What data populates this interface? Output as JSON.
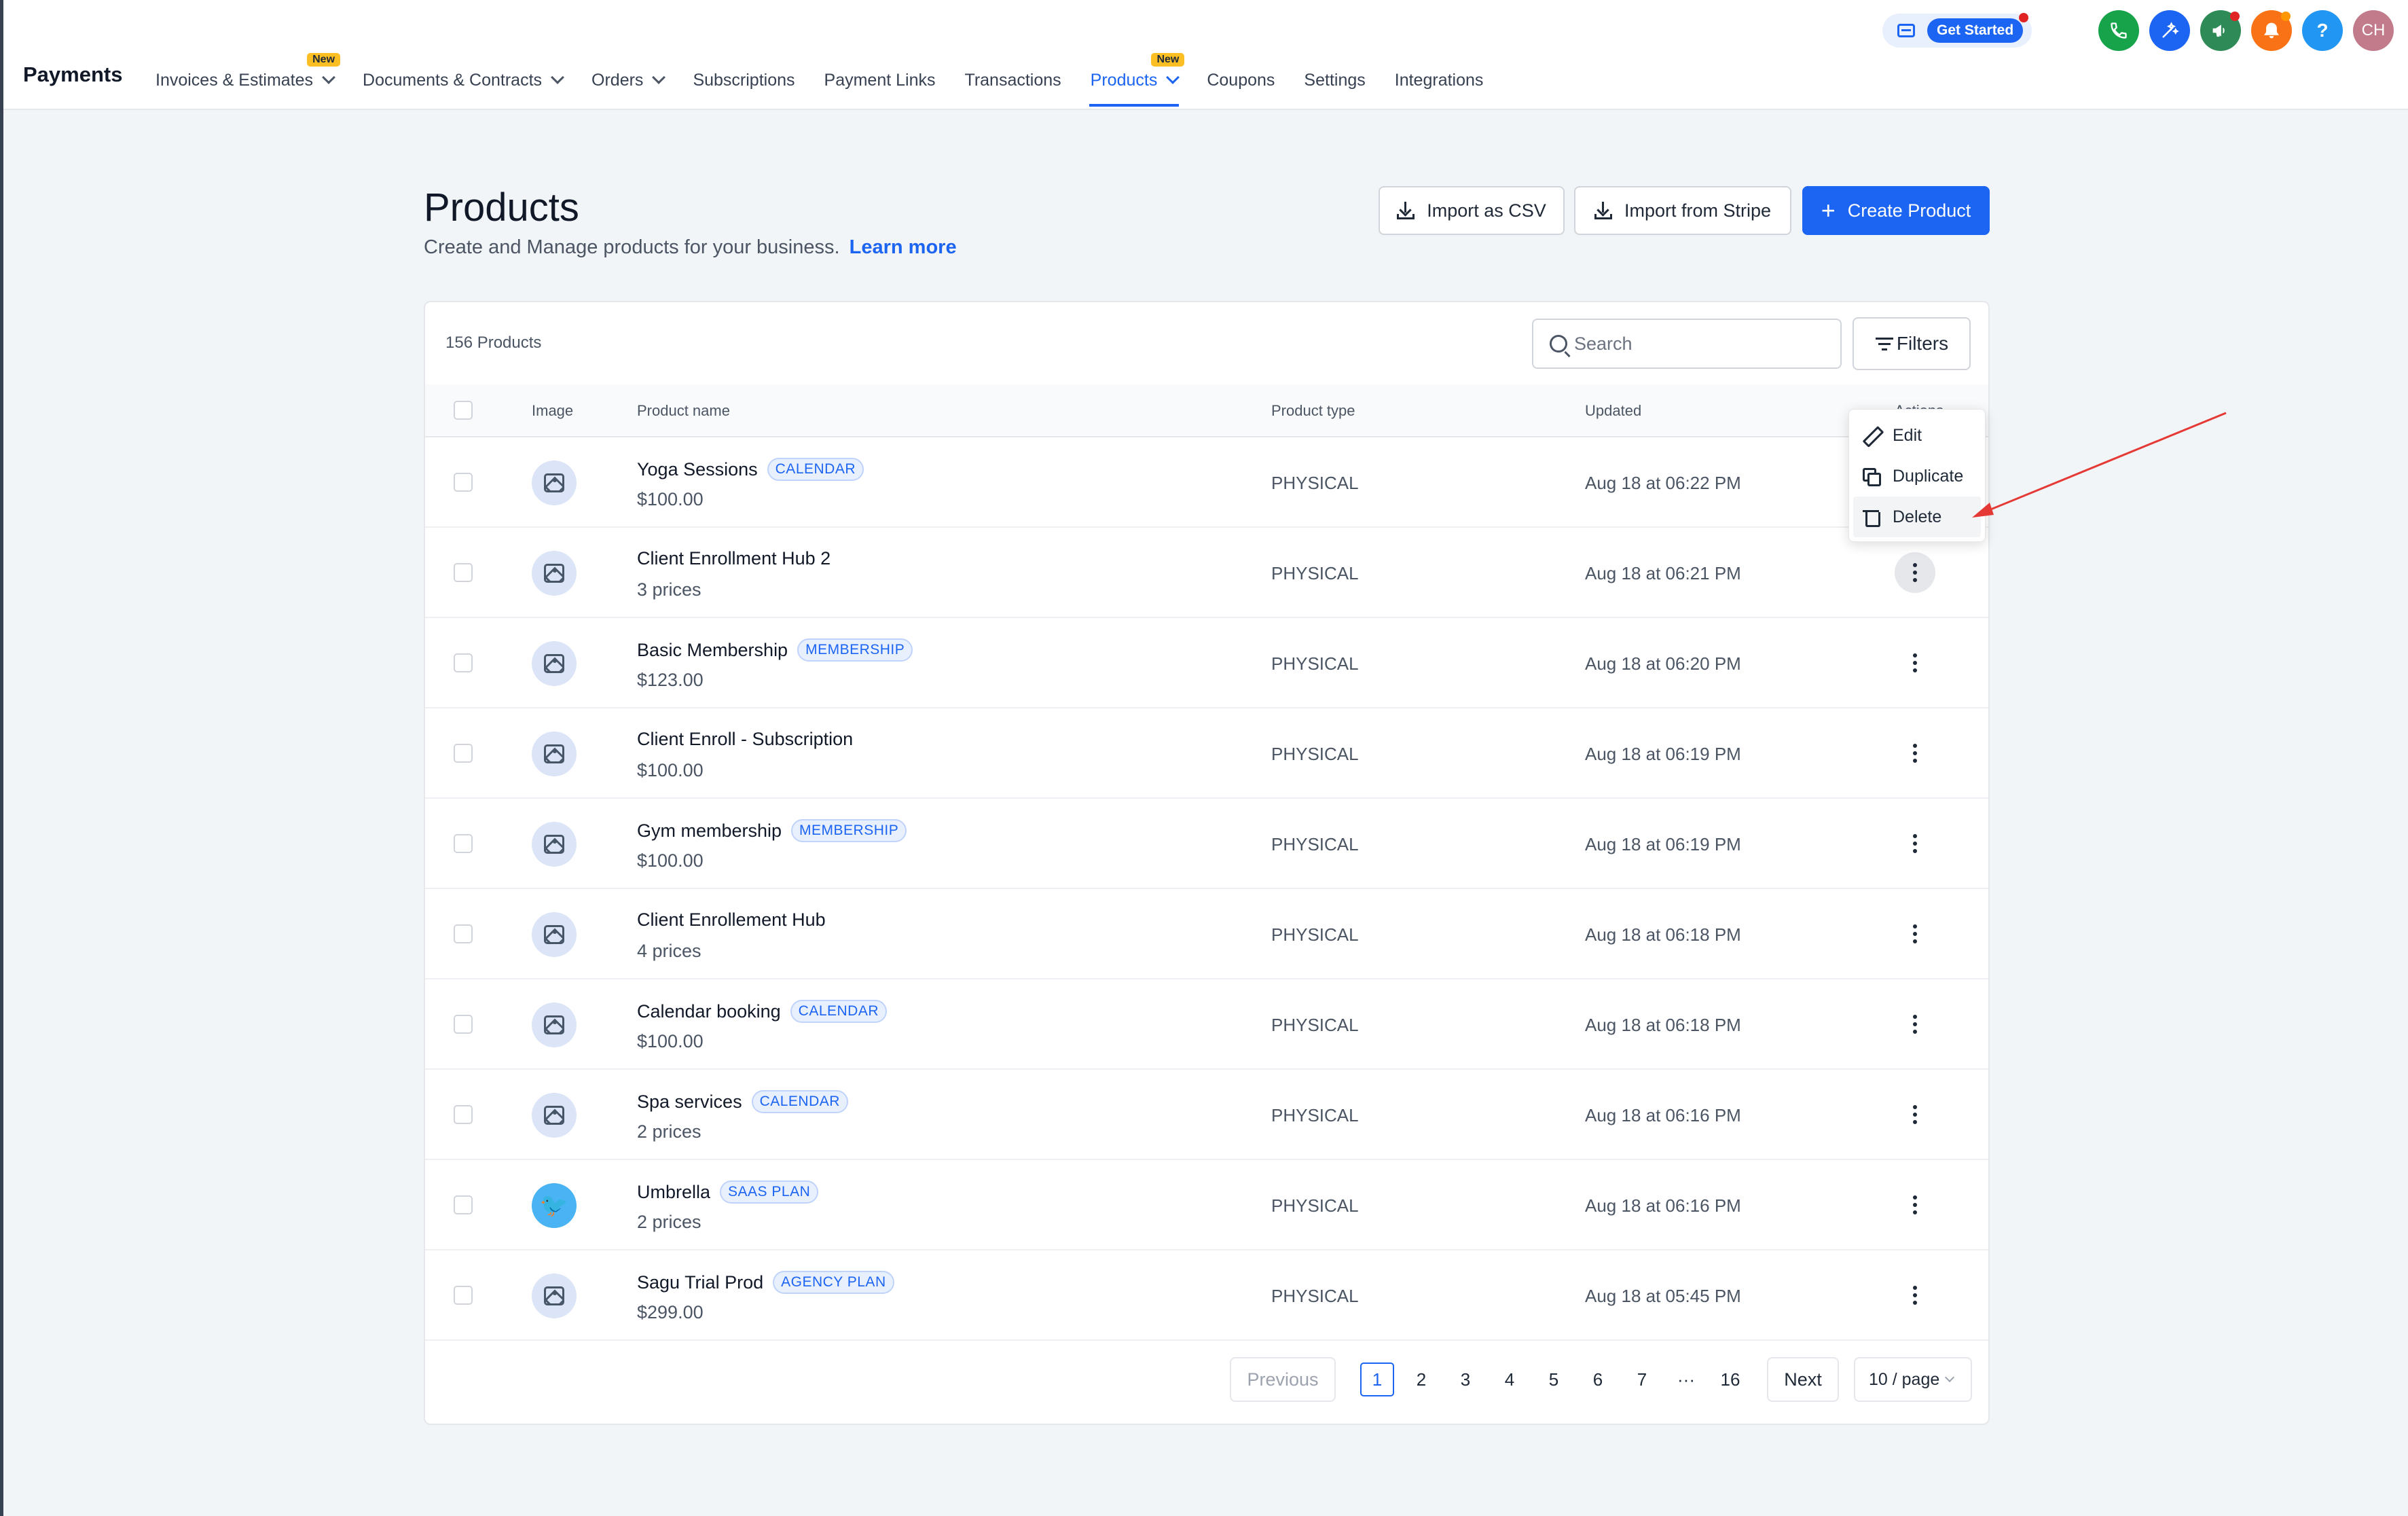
{
  "app": {
    "title": "Payments"
  },
  "nav": {
    "items": [
      {
        "label": "Invoices & Estimates",
        "dropdown": true,
        "badge": "New"
      },
      {
        "label": "Documents & Contracts",
        "dropdown": true
      },
      {
        "label": "Orders",
        "dropdown": true
      },
      {
        "label": "Subscriptions"
      },
      {
        "label": "Payment Links"
      },
      {
        "label": "Transactions"
      },
      {
        "label": "Products",
        "dropdown": true,
        "badge": "New",
        "active": true
      },
      {
        "label": "Coupons"
      },
      {
        "label": "Settings"
      },
      {
        "label": "Integrations"
      }
    ]
  },
  "topbar": {
    "get_started": "Get Started",
    "icons": [
      {
        "name": "phone-icon",
        "color": "#16a34a"
      },
      {
        "name": "magic-icon",
        "color": "#1c64f2"
      },
      {
        "name": "megaphone-icon",
        "color": "#2e8b57"
      },
      {
        "name": "bell-icon",
        "color": "#f97316"
      },
      {
        "name": "help-icon",
        "color": "#2196f3",
        "glyph": "?"
      },
      {
        "name": "avatar",
        "color": "#c27b8a",
        "glyph": "CH"
      }
    ]
  },
  "header": {
    "title": "Products",
    "subtitle": "Create and Manage products for your business.",
    "learn_more": "Learn more",
    "import_csv": "Import as CSV",
    "import_stripe": "Import from Stripe",
    "create": "Create Product"
  },
  "table": {
    "count": "156 Products",
    "search_placeholder": "Search",
    "filters": "Filters",
    "columns": {
      "image": "Image",
      "name": "Product name",
      "type": "Product type",
      "updated": "Updated",
      "actions": "Actions"
    },
    "rows": [
      {
        "name": "Yoga Sessions",
        "tag": "CALENDAR",
        "sub": "$100.00",
        "type": "PHYSICAL",
        "updated": "Aug 18 at 06:22 PM",
        "image": "placeholder"
      },
      {
        "name": "Client Enrollment Hub 2",
        "tag": "",
        "sub": "3 prices",
        "type": "PHYSICAL",
        "updated": "Aug 18 at 06:21 PM",
        "image": "placeholder"
      },
      {
        "name": "Basic Membership",
        "tag": "MEMBERSHIP",
        "sub": "$123.00",
        "type": "PHYSICAL",
        "updated": "Aug 18 at 06:20 PM",
        "image": "placeholder"
      },
      {
        "name": "Client Enroll - Subscription",
        "tag": "",
        "sub": "$100.00",
        "type": "PHYSICAL",
        "updated": "Aug 18 at 06:19 PM",
        "image": "placeholder"
      },
      {
        "name": "Gym membership",
        "tag": "MEMBERSHIP",
        "sub": "$100.00",
        "type": "PHYSICAL",
        "updated": "Aug 18 at 06:19 PM",
        "image": "placeholder"
      },
      {
        "name": "Client Enrollement Hub",
        "tag": "",
        "sub": "4 prices",
        "type": "PHYSICAL",
        "updated": "Aug 18 at 06:18 PM",
        "image": "placeholder"
      },
      {
        "name": "Calendar booking",
        "tag": "CALENDAR",
        "sub": "$100.00",
        "type": "PHYSICAL",
        "updated": "Aug 18 at 06:18 PM",
        "image": "placeholder"
      },
      {
        "name": "Spa services",
        "tag": "CALENDAR",
        "sub": "2 prices",
        "type": "PHYSICAL",
        "updated": "Aug 18 at 06:16 PM",
        "image": "placeholder"
      },
      {
        "name": "Umbrella",
        "tag": "SAAS PLAN",
        "sub": "2 prices",
        "type": "PHYSICAL",
        "updated": "Aug 18 at 06:16 PM",
        "image": "twitter"
      },
      {
        "name": "Sagu Trial Prod",
        "tag": "AGENCY PLAN",
        "sub": "$299.00",
        "type": "PHYSICAL",
        "updated": "Aug 18 at 05:45 PM",
        "image": "placeholder"
      }
    ]
  },
  "menu": {
    "edit": "Edit",
    "duplicate": "Duplicate",
    "delete": "Delete"
  },
  "pagination": {
    "previous": "Previous",
    "pages": [
      "1",
      "2",
      "3",
      "4",
      "5",
      "6",
      "7",
      "···",
      "16"
    ],
    "current": "1",
    "next": "Next",
    "page_size": "10 / page"
  },
  "colors": {
    "accent": "#1c64f2",
    "annotation_arrow": "#e53935"
  }
}
